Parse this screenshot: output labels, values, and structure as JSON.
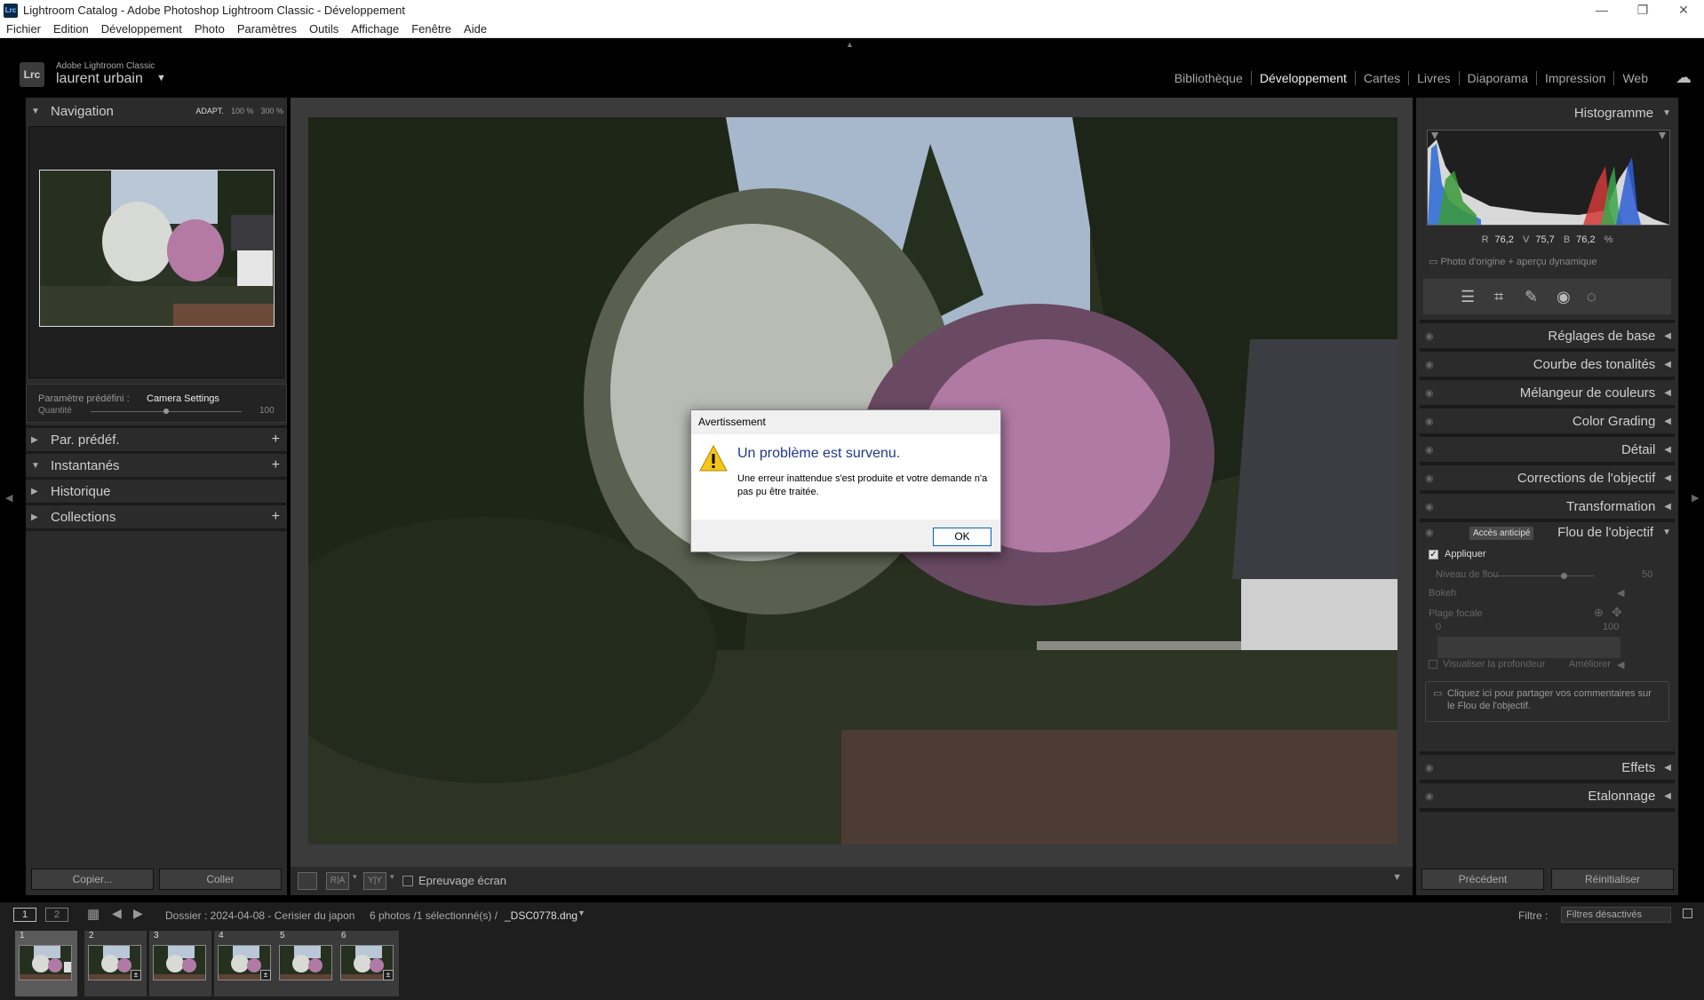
{
  "window": {
    "title": "Lightroom Catalog - Adobe Photoshop Lightroom Classic - Développement",
    "app_badge": "Lrc",
    "controls": [
      "—",
      "❐",
      "✕"
    ]
  },
  "menu": [
    "Fichier",
    "Edition",
    "Développement",
    "Photo",
    "Paramètres",
    "Outils",
    "Affichage",
    "Fenêtre",
    "Aide"
  ],
  "identity": {
    "logo": "Lrc",
    "brand": "Adobe Lightroom Classic",
    "user": "laurent urbain",
    "user_arrow": "▼"
  },
  "modules": [
    "Bibliothèque",
    "Développement",
    "Cartes",
    "Livres",
    "Diaporama",
    "Impression",
    "Web"
  ],
  "active_module": "Développement",
  "left": {
    "navigator": {
      "title": "Navigation",
      "fit": "ADAPT.",
      "zoom1": "100 %",
      "zoom2": "300 %"
    },
    "preset": {
      "label": "Paramètre prédéfini :",
      "value": "Camera Settings",
      "amount_label": "Quantité",
      "amount_value": "100",
      "amount_fraction": 0.5
    },
    "panels": [
      "Par. prédéf.",
      "Instantanés",
      "Historique",
      "Collections"
    ],
    "copy": "Copier...",
    "paste": "Coller"
  },
  "toolbar": {
    "softproof": "Epreuvage écran",
    "view_ra": "R|A",
    "view_yy": "Y|Y"
  },
  "right": {
    "histogram_title": "Histogramme",
    "rgb": {
      "r_label": "R",
      "r": "76,2",
      "v_label": "V",
      "v": "75,7",
      "b_label": "B",
      "b": "76,2",
      "unit": "%"
    },
    "origin": "Photo d'origine + aperçu dynamique",
    "panels": [
      "Réglages de base",
      "Courbe des tonalités",
      "Mélangeur de couleurs",
      "Color Grading",
      "Détail",
      "Corrections de l'objectif",
      "Transformation"
    ],
    "lens_blur": {
      "title": "Flou de l'objectif",
      "badge": "Accès anticipé",
      "apply": "Appliquer",
      "blur_level": "Niveau de flou",
      "blur_value": "50",
      "blur_fraction": 0.5,
      "bokeh": "Bokeh",
      "focal_range": "Plage focale",
      "range_min": "0",
      "range_max": "100",
      "visualize": "Visualiser la profondeur",
      "improve": "Améliorer",
      "share": "Cliquez ici pour partager vos commentaires sur le Flou de l'objectif."
    },
    "panels_after": [
      "Effets",
      "Etalonnage"
    ],
    "previous": "Précédent",
    "reset": "Réinitialiser"
  },
  "filmstrip": {
    "page1": "1",
    "page2": "2",
    "source": "Dossier : 2024-04-08 - Cerisier du japon",
    "count": "6 photos /1 sélectionné(s) /",
    "file": "_DSC0778.dng",
    "filter_label": "Filtre :",
    "filter_value": "Filtres désactivés",
    "cells": [
      "1",
      "2",
      "3",
      "4",
      "5",
      "6"
    ]
  },
  "dialog": {
    "title": "Avertissement",
    "heading": "Un problème est survenu.",
    "message": "Une erreur inattendue s'est produite et votre demande n'a pas pu être traitée.",
    "ok": "OK"
  },
  "colors": {
    "accent_dialog": "#1e3a8a",
    "ok_border": "#0067c0",
    "panel_bg": "#2b2b2b",
    "center_bg": "#3b3b3b"
  }
}
